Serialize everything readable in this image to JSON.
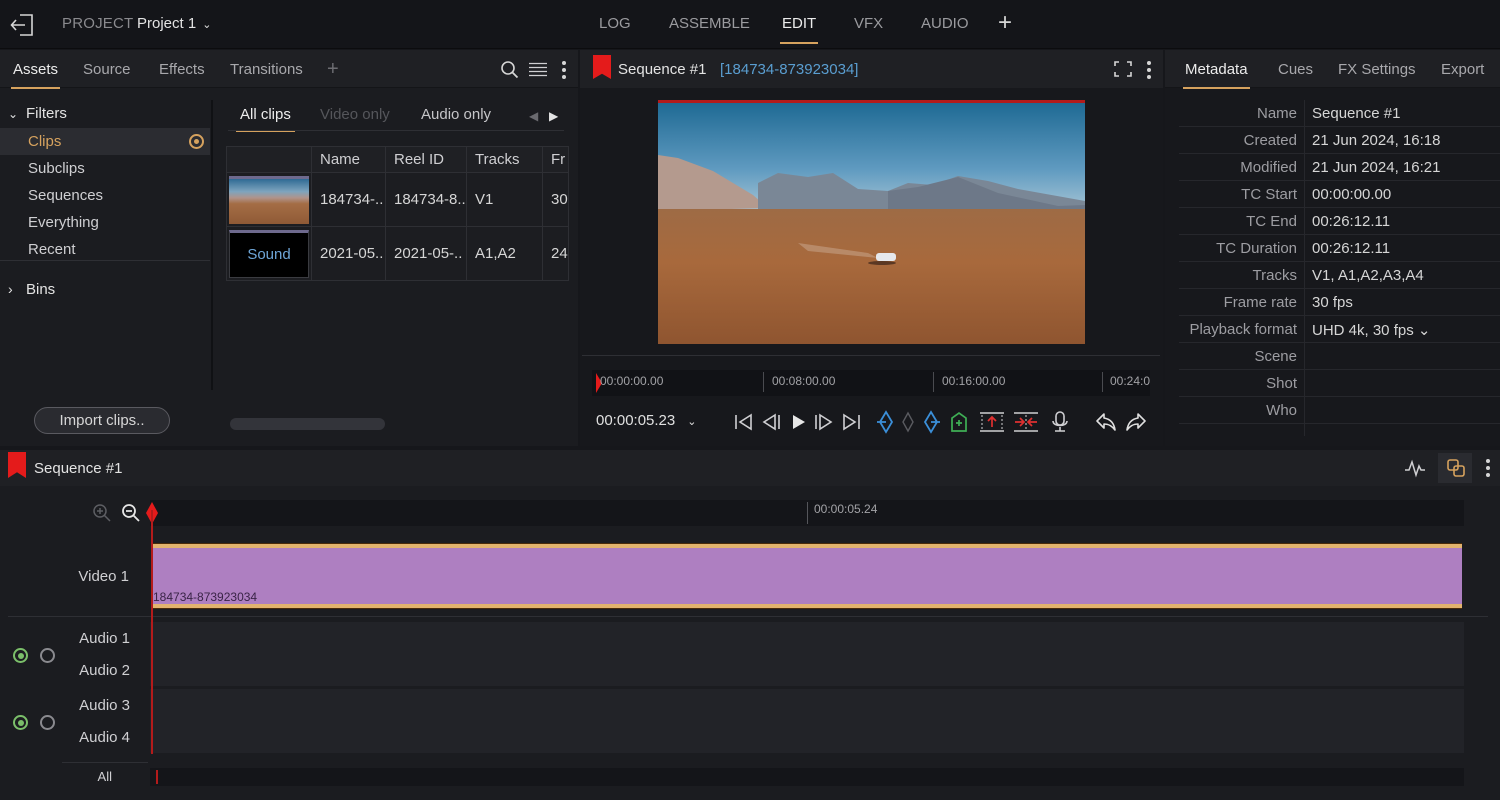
{
  "topbar": {
    "project_label": "PROJECT",
    "project_name": "Project 1",
    "modes": [
      {
        "label": "LOG",
        "active": false
      },
      {
        "label": "ASSEMBLE",
        "active": false
      },
      {
        "label": "EDIT",
        "active": true
      },
      {
        "label": "VFX",
        "active": false
      },
      {
        "label": "AUDIO",
        "active": false
      }
    ],
    "add_mode": "+"
  },
  "left_panel": {
    "tabs": [
      {
        "label": "Assets",
        "active": true
      },
      {
        "label": "Source",
        "active": false
      },
      {
        "label": "Effects",
        "active": false
      },
      {
        "label": "Transitions",
        "active": false
      }
    ],
    "add_tab": "+",
    "filters_label": "Filters",
    "filters": [
      {
        "label": "Clips",
        "active": true
      },
      {
        "label": "Subclips",
        "active": false
      },
      {
        "label": "Sequences",
        "active": false
      },
      {
        "label": "Everything",
        "active": false
      },
      {
        "label": "Recent",
        "active": false
      }
    ],
    "bins_label": "Bins",
    "import_button": "Import clips..",
    "clip_tabs": [
      {
        "label": "All clips",
        "state": "active"
      },
      {
        "label": "Video only",
        "state": "disabled"
      },
      {
        "label": "Audio only",
        "state": "normal"
      }
    ],
    "table": {
      "columns": [
        "",
        "Name",
        "Reel ID",
        "Tracks",
        "Fr"
      ],
      "rows": [
        {
          "thumb": "video",
          "thumb_label": "",
          "name": "184734-..",
          "reel_id": "184734-8..",
          "tracks": "V1",
          "fr": "30"
        },
        {
          "thumb": "sound",
          "thumb_label": "Sound",
          "name": "2021-05..",
          "reel_id": "2021-05-..",
          "tracks": "A1,A2",
          "fr": "24"
        }
      ]
    }
  },
  "viewer": {
    "title": "Sequence #1",
    "clip_id": "[184734-873923034]",
    "ruler_labels": [
      "00:00:00.00",
      "00:08:00.00",
      "00:16:00.00",
      "00:24:0"
    ],
    "timecode": "00:00:05.23",
    "colors": {
      "mark_blue": "#3b8fd9",
      "marker_green": "#3fae55",
      "lift_red": "#e03030"
    }
  },
  "metadata": {
    "tabs": [
      {
        "label": "Metadata",
        "active": true
      },
      {
        "label": "Cues",
        "active": false
      },
      {
        "label": "FX Settings",
        "active": false
      },
      {
        "label": "Export",
        "active": false
      }
    ],
    "rows": [
      {
        "key": "Name",
        "value": "Sequence #1"
      },
      {
        "key": "Created",
        "value": "21 Jun 2024, 16:18"
      },
      {
        "key": "Modified",
        "value": "21 Jun 2024, 16:21"
      },
      {
        "key": "TC Start",
        "value": "00:00:00.00"
      },
      {
        "key": "TC End",
        "value": "00:26:12.11"
      },
      {
        "key": "TC Duration",
        "value": "00:26:12.11"
      },
      {
        "key": "Tracks",
        "value": "V1, A1,A2,A3,A4"
      },
      {
        "key": "Frame rate",
        "value": "30 fps"
      },
      {
        "key": "Playback format",
        "value": "UHD 4k, 30 fps ⌄"
      },
      {
        "key": "Scene",
        "value": ""
      },
      {
        "key": "Shot",
        "value": ""
      },
      {
        "key": "Who",
        "value": ""
      }
    ]
  },
  "timeline": {
    "title": "Sequence #1",
    "ruler_label": "00:00:05.24",
    "tracks": {
      "video": "Video 1",
      "audio1": "Audio 1",
      "audio2": "Audio 2",
      "audio3": "Audio 3",
      "audio4": "Audio 4",
      "all": "All"
    },
    "clip_label": "184734-873923034",
    "clip_color": "#ae7fc1",
    "accent": "#d6a25e"
  }
}
